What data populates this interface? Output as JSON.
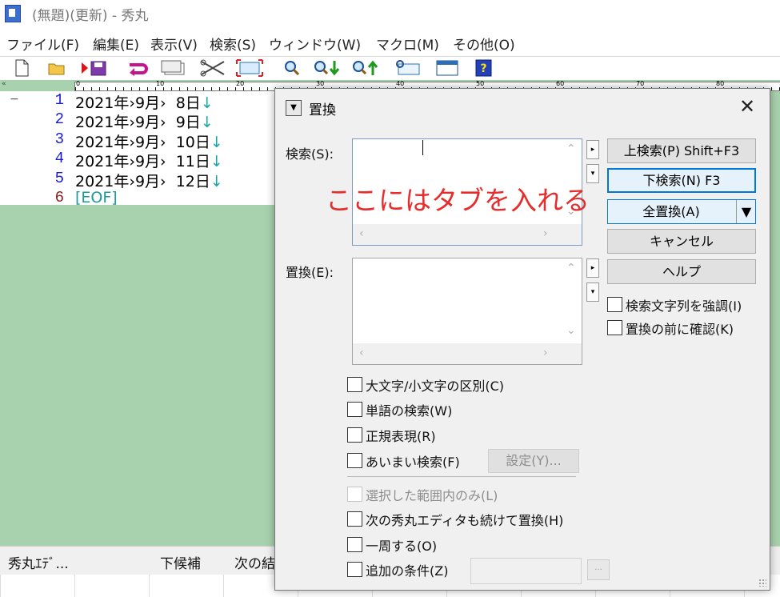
{
  "window": {
    "title": "(無題)(更新) - 秀丸"
  },
  "menu": [
    "ファイル(F)",
    "編集(E)",
    "表示(V)",
    "検索(S)",
    "ウィンドウ(W)",
    "マクロ(M)",
    "その他(O)"
  ],
  "ruler": {
    "marks": [
      "0",
      "10",
      "20",
      "30",
      "40",
      "50",
      "60",
      "70",
      "80"
    ]
  },
  "editor": {
    "lines": [
      {
        "num": "1",
        "text": "2021年›9月›  8日",
        "nl": "↓"
      },
      {
        "num": "2",
        "text": "2021年›9月›  9日",
        "nl": "↓"
      },
      {
        "num": "3",
        "text": "2021年›9月›  10日",
        "nl": "↓"
      },
      {
        "num": "4",
        "text": "2021年›9月›  11日",
        "nl": "↓"
      },
      {
        "num": "5",
        "text": "2021年›9月›  12日",
        "nl": "↓"
      },
      {
        "num": "6",
        "text": "[EOF]",
        "nl": ""
      }
    ],
    "fold_marker": "−",
    "colors": {
      "line_num": "#1a1ad6",
      "eof_num": "#8b1a1a",
      "eof": "#1a9a9a",
      "bg": "#a8d2ad"
    }
  },
  "statusbar": {
    "left": "秀丸ｴﾃﾞ...",
    "middle": "下候補",
    "right": "次の結"
  },
  "dialog": {
    "title": "置換",
    "search_label": "検索(S):",
    "replace_label": "置換(E):",
    "annotation": "ここにはタブを入れる",
    "buttons": {
      "search_up": "上検索(P) Shift+F3",
      "search_down": "下検索(N) F3",
      "replace_all": "全置換(A)",
      "cancel": "キャンセル",
      "help": "ヘルプ"
    },
    "right_checks": [
      {
        "label": "検索文字列を強調(I)",
        "checked": false
      },
      {
        "label": "置換の前に確認(K)",
        "checked": false
      }
    ],
    "checks": [
      {
        "label": "大文字/小文字の区別(C)",
        "checked": false,
        "disabled": false
      },
      {
        "label": "単語の検索(W)",
        "checked": false,
        "disabled": false
      },
      {
        "label": "正規表現(R)",
        "checked": false,
        "disabled": false
      },
      {
        "label": "あいまい検索(F)",
        "checked": false,
        "disabled": false
      },
      {
        "label": "選択した範囲内のみ(L)",
        "checked": false,
        "disabled": true
      },
      {
        "label": "次の秀丸エディタも続けて置換(H)",
        "checked": false,
        "disabled": false
      },
      {
        "label": "一周する(O)",
        "checked": false,
        "disabled": false
      },
      {
        "label": "追加の条件(Z)",
        "checked": false,
        "disabled": false
      }
    ],
    "settings_button": "設定(Y)...",
    "more_button": "..."
  },
  "toolbar_icons": [
    "new-file-icon",
    "open-folder-icon",
    "save-icon",
    "undo-icon",
    "copy-icon",
    "cut-icon",
    "paste-icon",
    "search-icon",
    "search-down-icon",
    "search-up-icon",
    "replace-icon",
    "window-icon",
    "help-icon"
  ]
}
